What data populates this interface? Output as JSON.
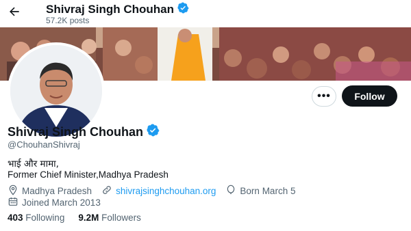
{
  "header": {
    "back_icon": "arrow-left-icon",
    "name": "Shivraj Singh Chouhan",
    "posts": "57.2K posts",
    "verified_icon": "verified-badge-icon",
    "verified_color": "#1d9bf0"
  },
  "actions": {
    "more_label": "•••",
    "follow_label": "Follow"
  },
  "profile": {
    "name": "Shivraj Singh Chouhan",
    "handle": "@ChouhanShivraj",
    "bio_line1": "भाई और मामा,",
    "bio_line2": "Former Chief Minister,Madhya Pradesh",
    "location": "Madhya Pradesh",
    "website": "shivrajsinghchouhan.org",
    "born": "Born March 5",
    "joined": "Joined March 2013"
  },
  "stats": {
    "following_count": "403",
    "following_label": "Following",
    "followers_count": "9.2M",
    "followers_label": "Followers"
  },
  "colors": {
    "accent": "#1d9bf0",
    "text_primary": "#0f1419",
    "text_secondary": "#536471"
  }
}
